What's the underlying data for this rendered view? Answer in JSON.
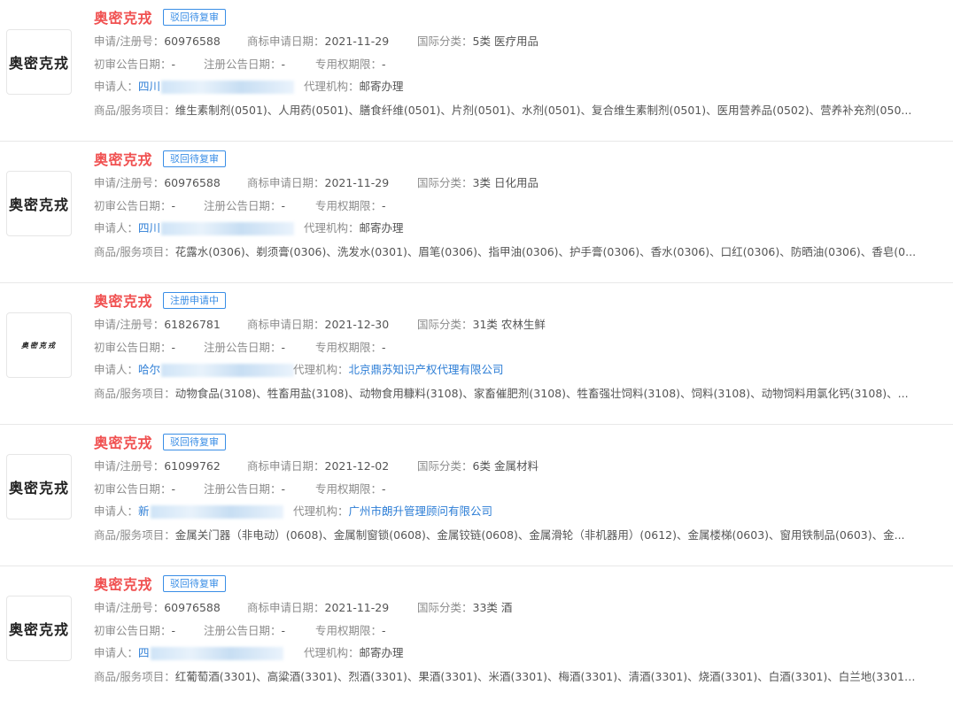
{
  "labels": {
    "reg_no": "申请/注册号：",
    "apply_date": "商标申请日期：",
    "intl_class": "国际分类：",
    "prelim_date": "初审公告日期：",
    "reg_date": "注册公告日期：",
    "exclusive": "专用权期限：",
    "applicant": "申请人：",
    "agency": "代理机构：",
    "goods": "商品/服务项目："
  },
  "items": [
    {
      "name": "奥密克戎",
      "status": "驳回待复审",
      "reg_no": "60976588",
      "apply_date": "2021-11-29",
      "intl_class": "5类 医疗用品",
      "prelim_date": "-",
      "reg_date": "-",
      "exclusive": "-",
      "applicant_prefix": "四川",
      "agency": "邮寄办理",
      "goods": "维生素制剂(0501)、人用药(0501)、膳食纤维(0501)、片剂(0501)、水剂(0501)、复合维生素制剂(0501)、医用营养品(0502)、营养补充剂(050..."
    },
    {
      "name": "奥密克戎",
      "status": "驳回待复审",
      "reg_no": "60976588",
      "apply_date": "2021-11-29",
      "intl_class": "3类 日化用品",
      "prelim_date": "-",
      "reg_date": "-",
      "exclusive": "-",
      "applicant_prefix": "四川",
      "agency": "邮寄办理",
      "goods": "花露水(0306)、剃须膏(0306)、洗发水(0301)、眉笔(0306)、指甲油(0306)、护手膏(0306)、香水(0306)、口红(0306)、防晒油(0306)、香皂(0..."
    },
    {
      "name": "奥密克戎",
      "status": "注册申请中",
      "reg_no": "61826781",
      "apply_date": "2021-12-30",
      "intl_class": "31类 农林生鲜",
      "prelim_date": "-",
      "reg_date": "-",
      "exclusive": "-",
      "applicant_prefix": "哈尔",
      "agency": "北京鼎苏知识产权代理有限公司",
      "goods": "动物食品(3108)、牲畜用盐(3108)、动物食用糠料(3108)、家畜催肥剂(3108)、牲畜强壮饲料(3108)、饲料(3108)、动物饲料用氯化钙(3108)、..."
    },
    {
      "name": "奥密克戎",
      "status": "驳回待复审",
      "reg_no": "61099762",
      "apply_date": "2021-12-02",
      "intl_class": "6类 金属材料",
      "prelim_date": "-",
      "reg_date": "-",
      "exclusive": "-",
      "applicant_prefix": "新",
      "agency": "广州市朗升管理顾问有限公司",
      "goods": "金属关门器（非电动）(0608)、金属制窗锁(0608)、金属铰链(0608)、金属滑轮（非机器用）(0612)、金属楼梯(0603)、窗用铁制品(0603)、金..."
    },
    {
      "name": "奥密克戎",
      "status": "驳回待复审",
      "reg_no": "60976588",
      "apply_date": "2021-11-29",
      "intl_class": "33类 酒",
      "prelim_date": "-",
      "reg_date": "-",
      "exclusive": "-",
      "applicant_prefix": "四",
      "agency": "邮寄办理",
      "goods": "红葡萄酒(3301)、高粱酒(3301)、烈酒(3301)、果酒(3301)、米酒(3301)、梅酒(3301)、清酒(3301)、烧酒(3301)、白酒(3301)、白兰地(3301)..."
    }
  ]
}
